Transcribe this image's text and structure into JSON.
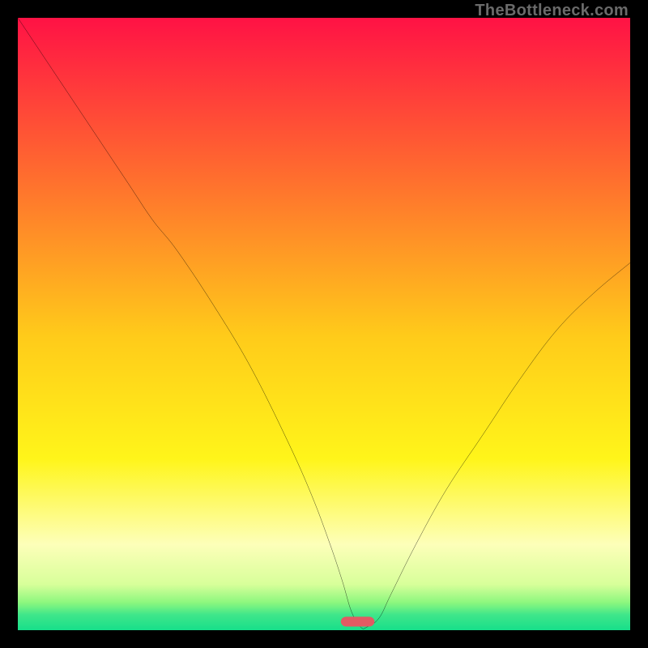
{
  "watermark": "TheBottleneck.com",
  "chart_data": {
    "type": "line",
    "title": "",
    "xlabel": "",
    "ylabel": "",
    "xlim": [
      0,
      100
    ],
    "ylim": [
      0,
      100
    ],
    "grid": false,
    "legend": false,
    "annotations": [],
    "series": [
      {
        "name": "curve",
        "x": [
          0,
          6,
          12,
          18,
          22,
          26,
          32,
          38,
          44,
          48,
          51,
          53,
          54.5,
          56,
          57,
          59,
          61,
          65,
          70,
          76,
          82,
          88,
          94,
          100
        ],
        "values": [
          100,
          91,
          82,
          73,
          67,
          62,
          53,
          43,
          31,
          22,
          14,
          8,
          3,
          0.5,
          0.5,
          2,
          6,
          14,
          23,
          32,
          41,
          49,
          55,
          60
        ]
      }
    ],
    "gradient_stops": [
      {
        "pct": 0,
        "color": "#ff1245"
      },
      {
        "pct": 25,
        "color": "#ff6a2f"
      },
      {
        "pct": 52,
        "color": "#ffcb1a"
      },
      {
        "pct": 72,
        "color": "#fff51a"
      },
      {
        "pct": 86,
        "color": "#fdffb9"
      },
      {
        "pct": 92.5,
        "color": "#d8ff9a"
      },
      {
        "pct": 95.5,
        "color": "#8cf77e"
      },
      {
        "pct": 97.5,
        "color": "#3fe68a"
      },
      {
        "pct": 100,
        "color": "#17df8a"
      }
    ],
    "marker": {
      "name": "minimum-marker",
      "x_center": 55.5,
      "y": 0.6,
      "width": 5.5,
      "color": "#e15a63"
    }
  }
}
